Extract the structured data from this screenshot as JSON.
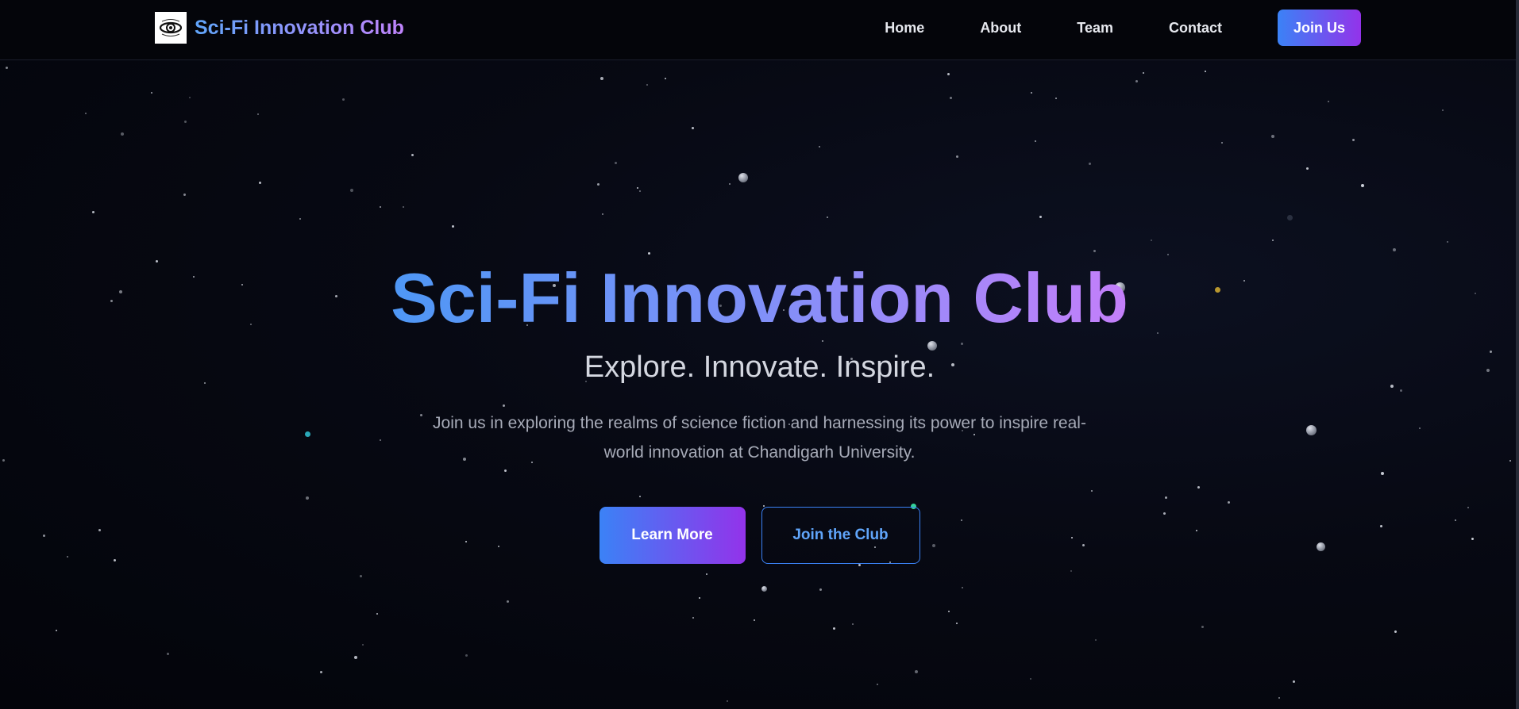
{
  "nav": {
    "brand": "Sci-Fi Innovation Club",
    "links": [
      "Home",
      "About",
      "Team",
      "Contact"
    ],
    "cta": "Join Us"
  },
  "hero": {
    "title": "Sci-Fi Innovation Club",
    "tagline": "Explore. Innovate. Inspire.",
    "description": "Join us in exploring the realms of science fiction and harnessing its power to inspire real-world innovation at Chandigarh University.",
    "primary_button": "Learn More",
    "secondary_button": "Join the Club"
  },
  "colors": {
    "background": "#05060d",
    "accent_blue": "#3b82f6",
    "accent_purple": "#9333ea",
    "gradient_text_start": "#60a5fa",
    "gradient_text_end": "#c084fc"
  },
  "icons": {
    "brand_logo": "eye-ring-logo-icon"
  }
}
